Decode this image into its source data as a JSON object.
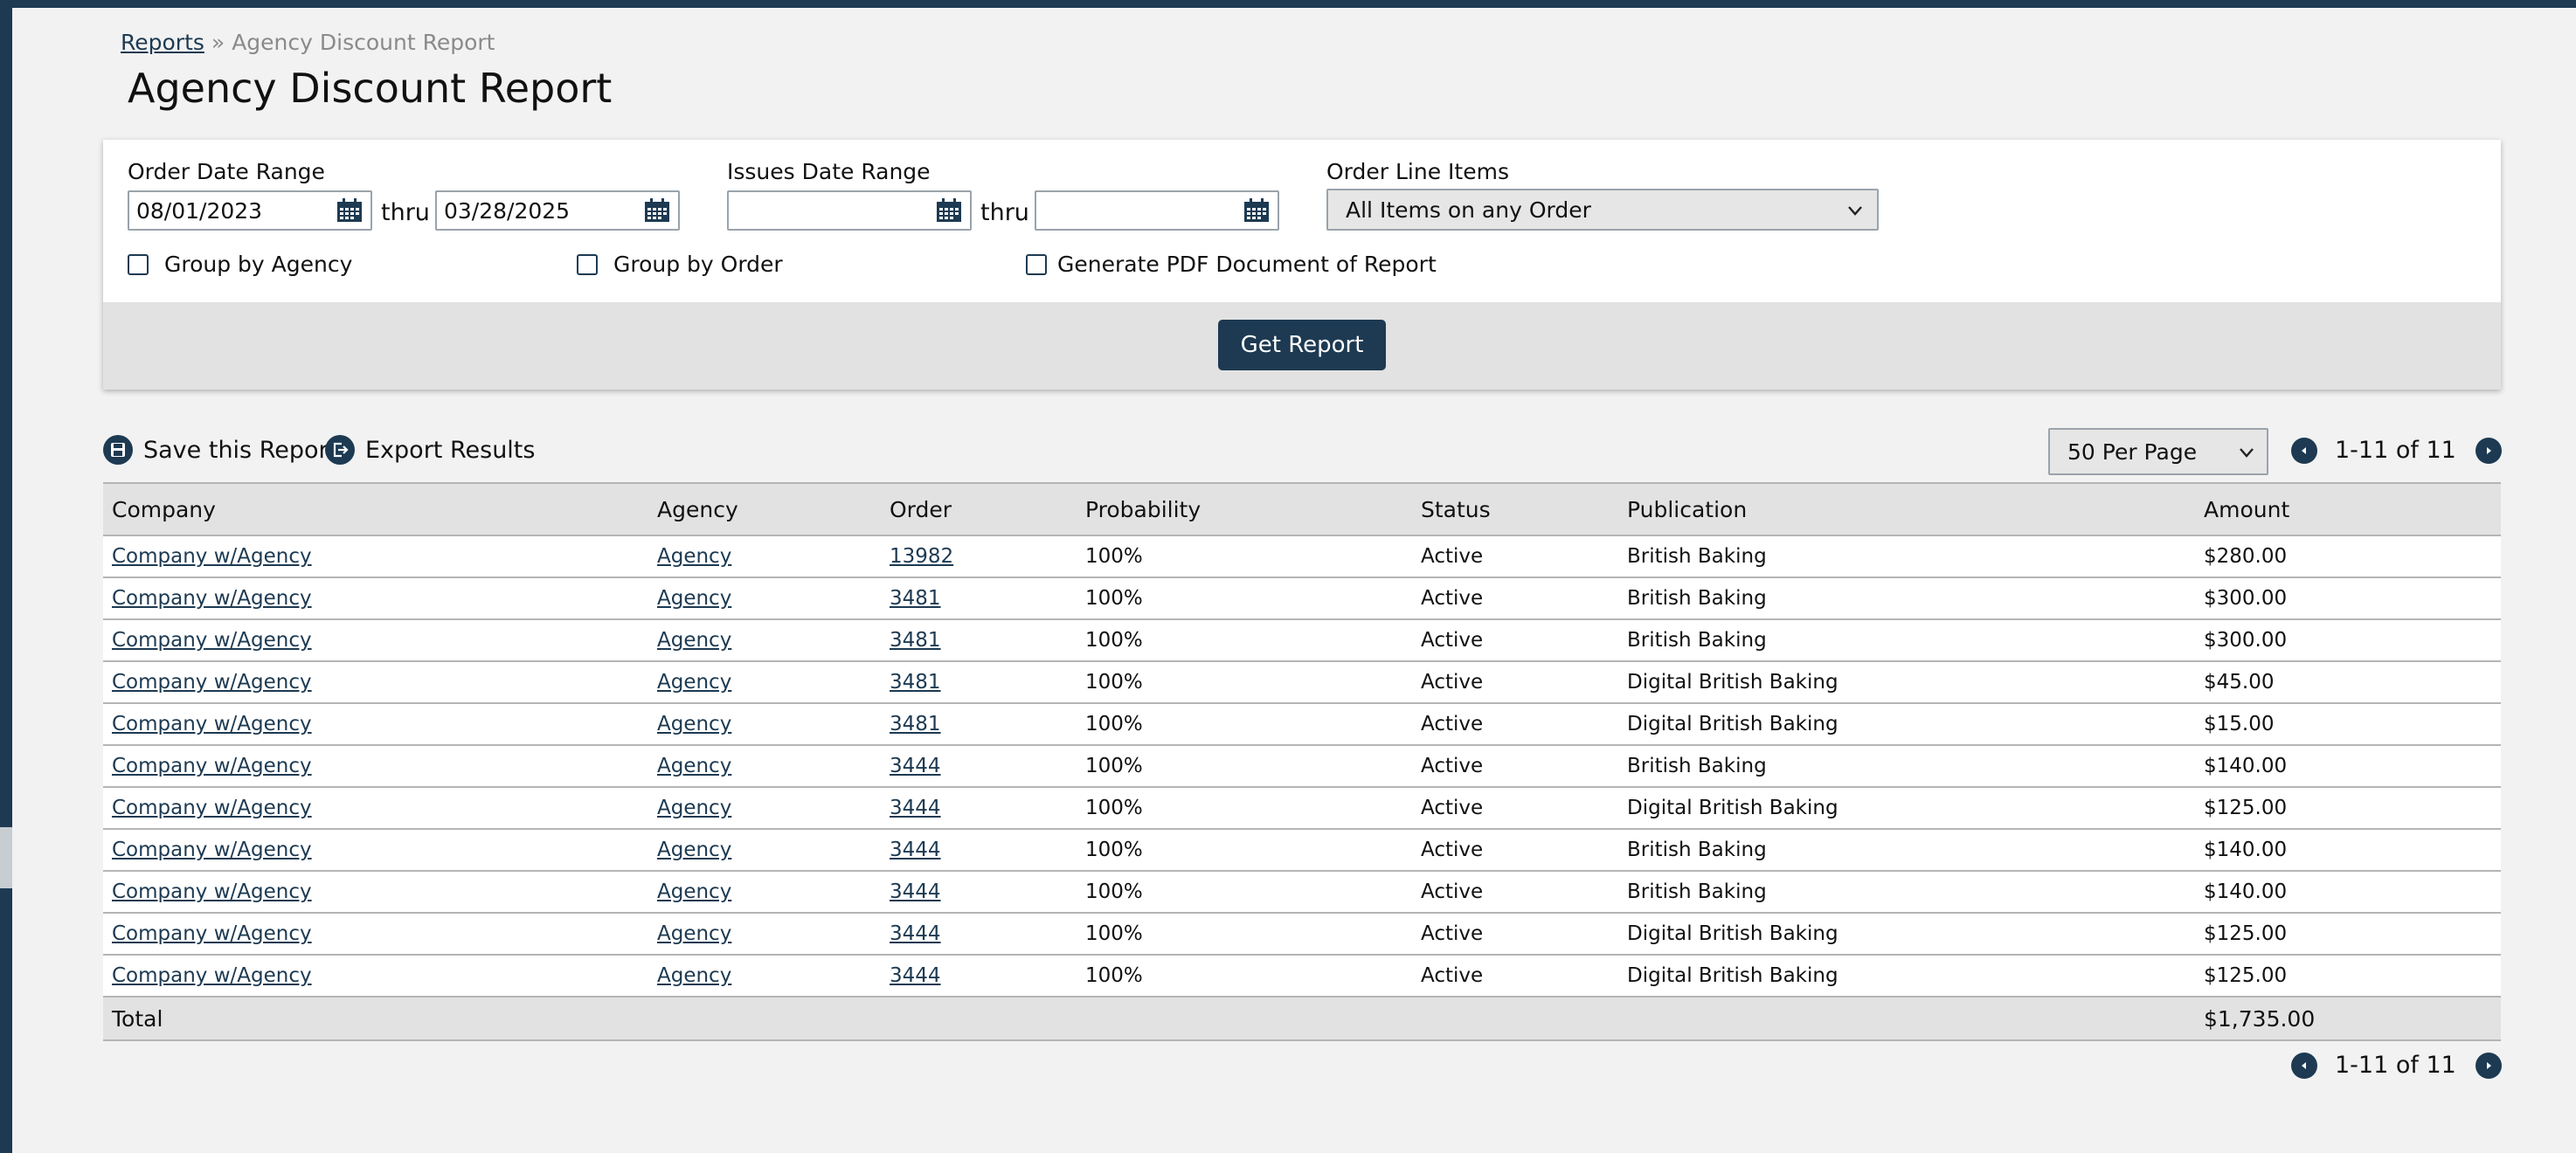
{
  "breadcrumb": {
    "root": "Reports",
    "separator": "»",
    "current": "Agency Discount Report"
  },
  "page_title": "Agency Discount Report",
  "filters": {
    "order_date_range": {
      "label": "Order Date Range",
      "from": "08/01/2023",
      "thru_label": "thru",
      "to": "03/28/2025"
    },
    "issues_date_range": {
      "label": "Issues Date Range",
      "from": "",
      "thru_label": "thru",
      "to": ""
    },
    "order_line_items": {
      "label": "Order Line Items",
      "selected": "All Items on any Order"
    },
    "group_by_agency": {
      "label": "Group by Agency",
      "checked": false
    },
    "group_by_order": {
      "label": "Group by Order",
      "checked": false
    },
    "generate_pdf": {
      "label": "Generate PDF Document of Report",
      "checked": false
    },
    "get_report_label": "Get Report"
  },
  "actions": {
    "save_label": "Save this Report",
    "export_label": "Export Results"
  },
  "pagination": {
    "per_page": "50 Per Page",
    "range_text": "1-11 of 11"
  },
  "table": {
    "columns": [
      "Company",
      "Agency",
      "Order",
      "Probability",
      "Status",
      "Publication",
      "Amount"
    ],
    "rows": [
      {
        "company": "Company w/Agency",
        "agency": "Agency",
        "order": "13982",
        "probability": "100%",
        "status": "Active",
        "publication": "British Baking",
        "amount": "$280.00"
      },
      {
        "company": "Company w/Agency",
        "agency": "Agency",
        "order": "3481",
        "probability": "100%",
        "status": "Active",
        "publication": "British Baking",
        "amount": "$300.00"
      },
      {
        "company": "Company w/Agency",
        "agency": "Agency",
        "order": "3481",
        "probability": "100%",
        "status": "Active",
        "publication": "British Baking",
        "amount": "$300.00"
      },
      {
        "company": "Company w/Agency",
        "agency": "Agency",
        "order": "3481",
        "probability": "100%",
        "status": "Active",
        "publication": "Digital British Baking",
        "amount": "$45.00"
      },
      {
        "company": "Company w/Agency",
        "agency": "Agency",
        "order": "3481",
        "probability": "100%",
        "status": "Active",
        "publication": "Digital British Baking",
        "amount": "$15.00"
      },
      {
        "company": "Company w/Agency",
        "agency": "Agency",
        "order": "3444",
        "probability": "100%",
        "status": "Active",
        "publication": "British Baking",
        "amount": "$140.00"
      },
      {
        "company": "Company w/Agency",
        "agency": "Agency",
        "order": "3444",
        "probability": "100%",
        "status": "Active",
        "publication": "Digital British Baking",
        "amount": "$125.00"
      },
      {
        "company": "Company w/Agency",
        "agency": "Agency",
        "order": "3444",
        "probability": "100%",
        "status": "Active",
        "publication": "British Baking",
        "amount": "$140.00"
      },
      {
        "company": "Company w/Agency",
        "agency": "Agency",
        "order": "3444",
        "probability": "100%",
        "status": "Active",
        "publication": "British Baking",
        "amount": "$140.00"
      },
      {
        "company": "Company w/Agency",
        "agency": "Agency",
        "order": "3444",
        "probability": "100%",
        "status": "Active",
        "publication": "Digital British Baking",
        "amount": "$125.00"
      },
      {
        "company": "Company w/Agency",
        "agency": "Agency",
        "order": "3444",
        "probability": "100%",
        "status": "Active",
        "publication": "Digital British Baking",
        "amount": "$125.00"
      }
    ],
    "total_label": "Total",
    "total_amount": "$1,735.00"
  },
  "theme": {
    "primary": "#1d3a52",
    "panel_gray": "#e2e2e2",
    "background": "#f2f2f2"
  }
}
